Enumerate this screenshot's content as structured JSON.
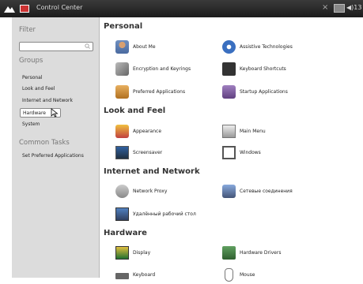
{
  "window": {
    "title": "Control Center"
  },
  "topbar": {
    "close_glyph": "×",
    "tray_text": "◀)13",
    "icons": [
      "distro-logo-icon",
      "app-icon",
      "monitor-icon",
      "volume-icon"
    ]
  },
  "sidebar": {
    "filter_heading": "Filter",
    "search_value": "",
    "groups_heading": "Groups",
    "groups": [
      {
        "label": "Personal"
      },
      {
        "label": "Look and Feel"
      },
      {
        "label": "Internet and Network"
      },
      {
        "label": "Hardware",
        "selected": true
      },
      {
        "label": "System"
      }
    ],
    "tasks_heading": "Common Tasks",
    "tasks": [
      {
        "label": "Set Preferred Applications"
      }
    ]
  },
  "main": {
    "sections": [
      {
        "title": "Personal",
        "items": [
          {
            "label": "About Me",
            "icon": "person-icon"
          },
          {
            "label": "Assistive Technologies",
            "icon": "accessibility-icon"
          },
          {
            "label": "Encryption and Keyrings",
            "icon": "keys-icon"
          },
          {
            "label": "Keyboard Shortcuts",
            "icon": "keyboard-icon"
          },
          {
            "label": "Preferred Applications",
            "icon": "preferred-apps-icon"
          },
          {
            "label": "Startup Applications",
            "icon": "startup-icon"
          }
        ]
      },
      {
        "title": "Look and Feel",
        "items": [
          {
            "label": "Appearance",
            "icon": "appearance-icon"
          },
          {
            "label": "Main Menu",
            "icon": "menu-icon"
          },
          {
            "label": "Screensaver",
            "icon": "screensaver-icon"
          },
          {
            "label": "Windows",
            "icon": "windows-icon"
          }
        ]
      },
      {
        "title": "Internet and Network",
        "items": [
          {
            "label": "Network Proxy",
            "icon": "proxy-icon"
          },
          {
            "label": "Сетевые соединения",
            "icon": "network-icon"
          },
          {
            "label": "Удалённый рабочий стол",
            "icon": "remote-desktop-icon"
          }
        ]
      },
      {
        "title": "Hardware",
        "items": [
          {
            "label": "Display",
            "icon": "display-icon"
          },
          {
            "label": "Hardware Drivers",
            "icon": "drivers-icon"
          },
          {
            "label": "Keyboard",
            "icon": "keyboard-icon"
          },
          {
            "label": "Mouse",
            "icon": "mouse-icon"
          }
        ]
      }
    ]
  }
}
